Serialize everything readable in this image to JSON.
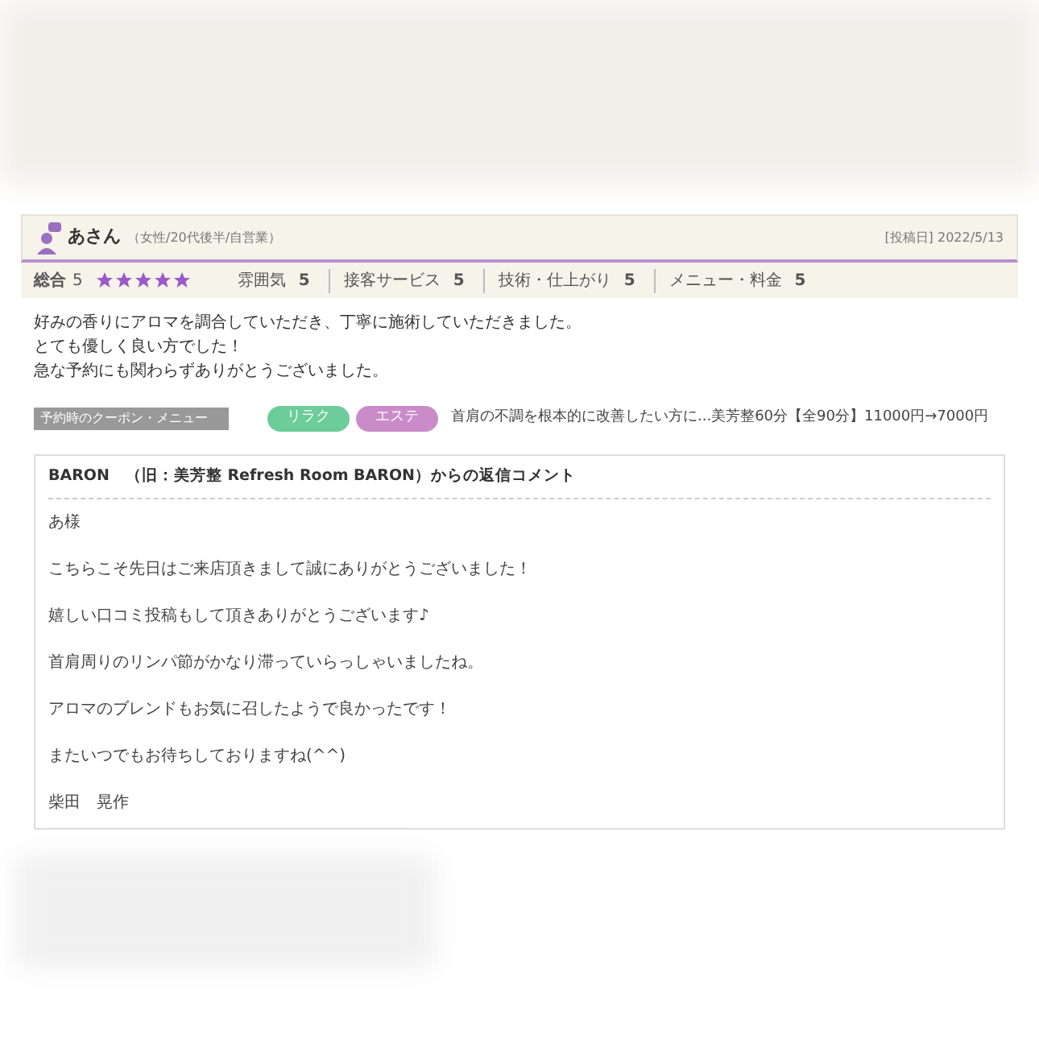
{
  "review": {
    "reviewer": "あさん",
    "profile": "（女性/20代後半/自営業）",
    "posted": "[投稿日] 2022/5/13",
    "overall_label": "総合",
    "overall_score": "5",
    "stars": 5,
    "ratings": [
      {
        "label": "雰囲気",
        "score": "5"
      },
      {
        "label": "接客サービス",
        "score": "5"
      },
      {
        "label": "技術・仕上がり",
        "score": "5"
      },
      {
        "label": "メニュー・料金",
        "score": "5"
      }
    ],
    "body": [
      "好みの香りにアロマを調合していただき、丁寧に施術していただきました。",
      "とても優しく良い方でした！",
      "急な予約にも関わらずありがとうございました。"
    ],
    "coupon_label": "予約時のクーポン・メニュー",
    "tags": [
      {
        "label": "リラク",
        "color": "#6ccc9a"
      },
      {
        "label": "エステ",
        "color": "#c98cc9"
      }
    ],
    "coupon": "首肩の不調を根本的に改善したい方に...美芳整60分【全90分】11000円→7000円"
  },
  "reply": {
    "title": "BARON　（旧：美芳整 Refresh Room BARON）からの返信コメント",
    "lines": [
      "あ様",
      "こちらこそ先日はご来店頂きまして誠にありがとうございました！",
      "嬉しい口コミ投稿もして頂きありがとうございます♪",
      "首肩周りのリンパ節がかなり滞っていらっしゃいましたね。",
      "アロマのブレンドもお気に召したようで良かったです！",
      "またいつでもお待ちしておりますね(^^)",
      "柴田　晃作"
    ]
  }
}
